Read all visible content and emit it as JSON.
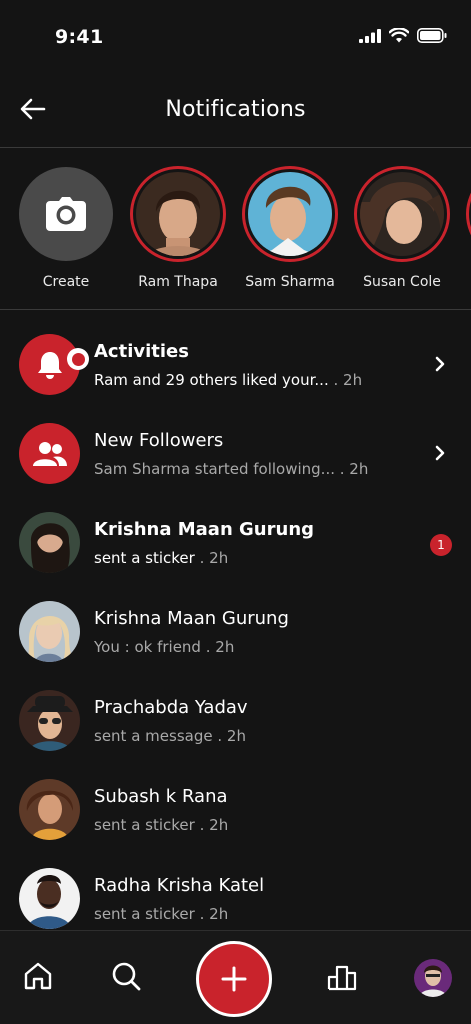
{
  "status_bar": {
    "time": "9:41"
  },
  "header": {
    "title": "Notifications"
  },
  "stories": [
    {
      "label": "Create",
      "icon": "camera-icon"
    },
    {
      "label": "Ram Thapa"
    },
    {
      "label": "Sam Sharma"
    },
    {
      "label": "Susan Cole"
    }
  ],
  "notifications": [
    {
      "title": "Activities",
      "subtitle": "Ram and 29 others liked your...",
      "time": ". 2h",
      "icon": "bell-icon"
    },
    {
      "title": "New Followers",
      "subtitle": "Sam Sharma started following...",
      "time": ". 2h",
      "icon": "users-icon"
    },
    {
      "title": "Krishna Maan Gurung",
      "subtitle": "sent a sticker",
      "time": ". 2h",
      "badge": "1"
    },
    {
      "title": "Krishna Maan Gurung",
      "subtitle": "You : ok friend",
      "time": ". 2h"
    },
    {
      "title": "Prachabda Yadav",
      "subtitle": "sent a message",
      "time": ". 2h"
    },
    {
      "title": "Subash k Rana",
      "subtitle": "sent a sticker",
      "time": ". 2h"
    },
    {
      "title": "Radha Krisha Katel",
      "subtitle": "sent a sticker",
      "time": ". 2h"
    }
  ],
  "colors": {
    "accent": "#c9232c",
    "background": "#141414",
    "muted_text": "#a9a9a9"
  },
  "bottom_nav": {
    "items": [
      "home-icon",
      "search-icon",
      "add-icon",
      "leaderboard-icon",
      "profile-avatar"
    ]
  }
}
